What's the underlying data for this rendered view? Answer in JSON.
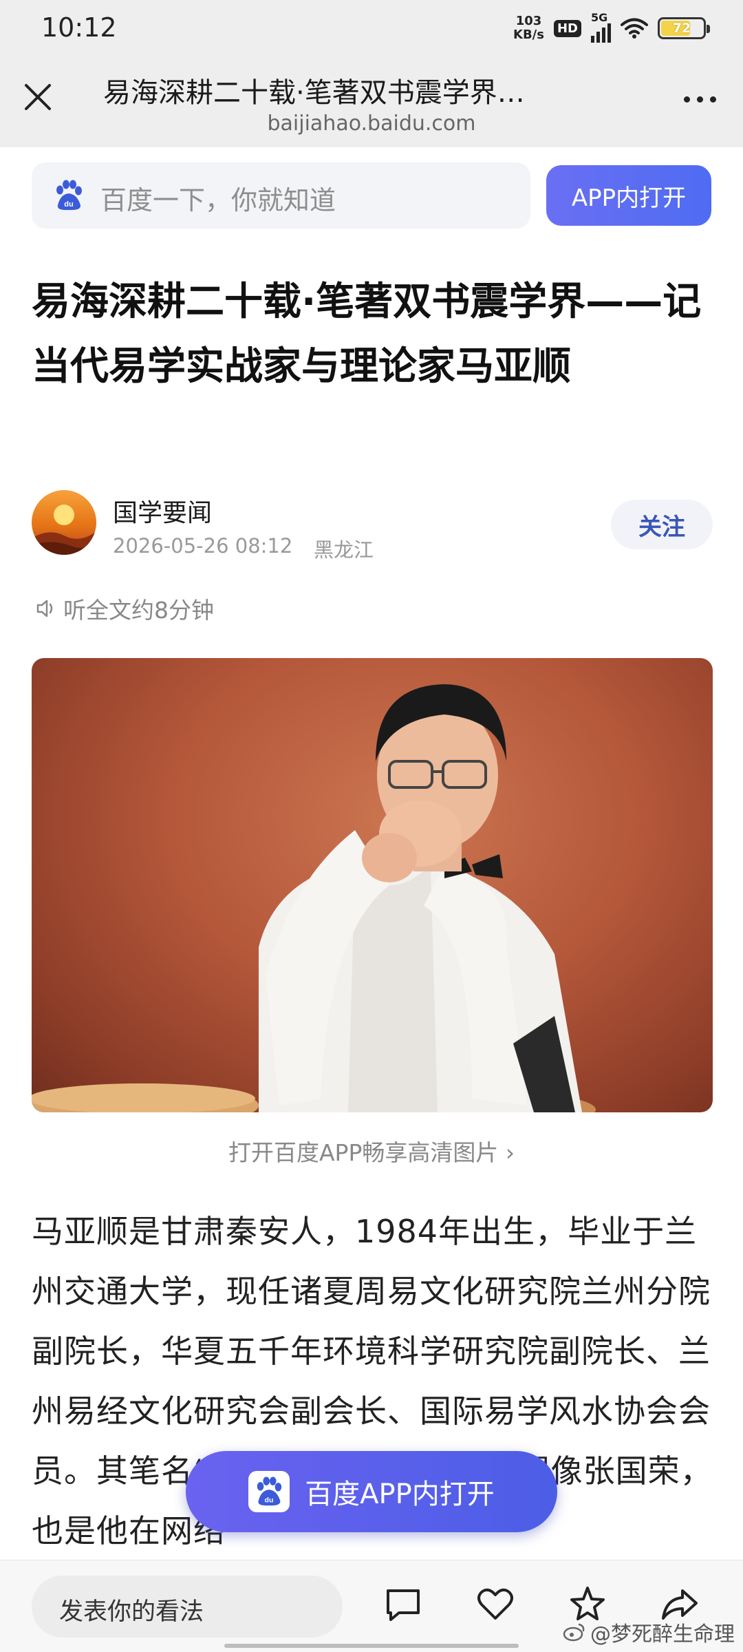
{
  "status_bar": {
    "time": "10:12",
    "net_speed_value": "103",
    "net_speed_unit": "KB/s",
    "hd_badge": "HD",
    "network_type": "5G",
    "battery_level": "72",
    "icons": [
      "hd-icon",
      "signal-icon",
      "wifi-icon",
      "battery-icon"
    ]
  },
  "nav": {
    "title": "易海深耕二十载·笔著双书震学界…",
    "domain": "baijiahao.baidu.com",
    "icons": [
      "close-icon",
      "more-icon"
    ]
  },
  "search": {
    "placeholder": "百度一下，你就知道",
    "app_button_label": "APP内打开",
    "icon": "baidu-paw-logo"
  },
  "article": {
    "title": "易海深耕二十载·笔著双书震学界——记当代易学实战家与理论家马亚顺",
    "author": {
      "name": "国学要闻",
      "date": "2026-05-26 08:12",
      "location": "黑龙江",
      "follow_label": "关注"
    },
    "listen_label": "听全文约8分钟",
    "photo_caption": "打开百度APP畅享高清图片 ›",
    "body": "马亚顺是甘肃秦安人，1984年出生，毕业于兰州交通大学，现任诸夏周易文化研究院兰州分院副院长，华夏五千年环境科学研究院副院长、兰州易经文化研究会副会长、国际易学风水协会会员。其笔名“梦死醉生”，既是致敬偶像张国荣，也是他在网络"
  },
  "float_button": {
    "label": "百度APP内打开",
    "icon": "baidu-app-logo"
  },
  "bottom_bar": {
    "comment_placeholder": "发表你的看法",
    "icons": [
      "comment-icon",
      "like-icon",
      "star-icon",
      "share-icon"
    ],
    "watermark": "@梦死醉生命理"
  },
  "colors": {
    "accent": "#4e6cf2",
    "follow_text": "#3a55b8",
    "photo_background": "#b4573a"
  }
}
